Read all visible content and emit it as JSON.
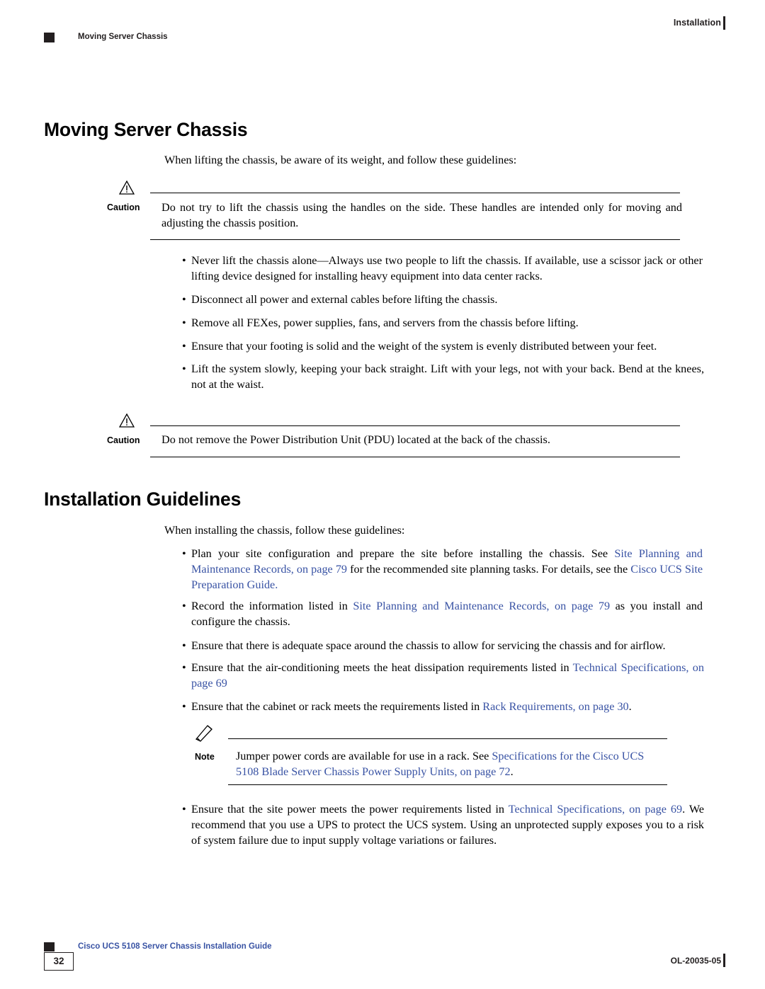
{
  "header": {
    "right_label": "Installation",
    "left_label": "Moving Server Chassis"
  },
  "sections": [
    {
      "title": "Moving Server Chassis",
      "intro": "When lifting the chassis, be aware of its weight, and follow these guidelines:"
    },
    {
      "title": "Installation Guidelines",
      "intro": "When installing the chassis, follow these guidelines:"
    }
  ],
  "caution1": {
    "label": "Caution",
    "text": "Do not try to lift the chassis using the handles on the side. These handles are intended only for moving and adjusting the chassis position."
  },
  "caution2": {
    "label": "Caution",
    "text": "Do not remove the Power Distribution Unit (PDU) located at the back of the chassis."
  },
  "note1": {
    "label": "Note",
    "text_lead": "Jumper power cords are available for use in a rack. See ",
    "link1": "Specifications for the Cisco UCS 5108 Blade Server Chassis Power Supply Units,  on page  72",
    "tail": "."
  },
  "bullets_moving": [
    "Never lift the chassis alone—Always use two people to lift the chassis. If available, use a scissor jack or other lifting device designed for installing heavy equipment into data center racks.",
    "Disconnect all power and external cables before lifting the chassis.",
    "Remove all FEXes, power supplies, fans, and servers from the chassis before lifting.",
    "Ensure that your footing is solid and the weight of the system is evenly distributed between your feet.",
    "Lift the system slowly, keeping your back straight. Lift with your legs, not with your back. Bend at the knees, not at the waist."
  ],
  "bullets_install": {
    "b1": {
      "p1": "Plan your site configuration and prepare the site before installing the chassis. See ",
      "l1": "Site Planning and Maintenance Records,  on page  79",
      "p2": " for the recommended site planning tasks. For details, see the ",
      "l2": "Cisco UCS Site Preparation Guide",
      "p3": "."
    },
    "b2": {
      "p1": "Record the information listed in ",
      "l1": "Site Planning and Maintenance Records,  on page  79",
      "p2": " as you install and configure the chassis."
    },
    "b3": {
      "p1": "Ensure that there is adequate space around the chassis to allow for servicing the chassis and for airflow."
    },
    "b4": {
      "p1": "Ensure that the air-conditioning meets the heat dissipation requirements listed in ",
      "l1": "Technical Specifications,  on page  69"
    },
    "b5": {
      "p1": "Ensure that the cabinet or rack meets the requirements listed in ",
      "l1": "Rack Requirements,  on page  30",
      "p2": "."
    },
    "b6": {
      "p1": "Ensure that the site power meets the power requirements listed in ",
      "l1": "Technical Specifications,  on page  69",
      "p2": ". We recommend that you use a UPS to protect the UCS system. Using an unprotected supply exposes you to a risk of system failure due to input supply voltage variations or failures."
    }
  },
  "footer": {
    "guide_title": "Cisco UCS 5108 Server Chassis Installation Guide",
    "page_number": "32",
    "doc_id": "OL-20035-05"
  },
  "colors": {
    "link": "#3953a4",
    "ink": "#231f20"
  }
}
